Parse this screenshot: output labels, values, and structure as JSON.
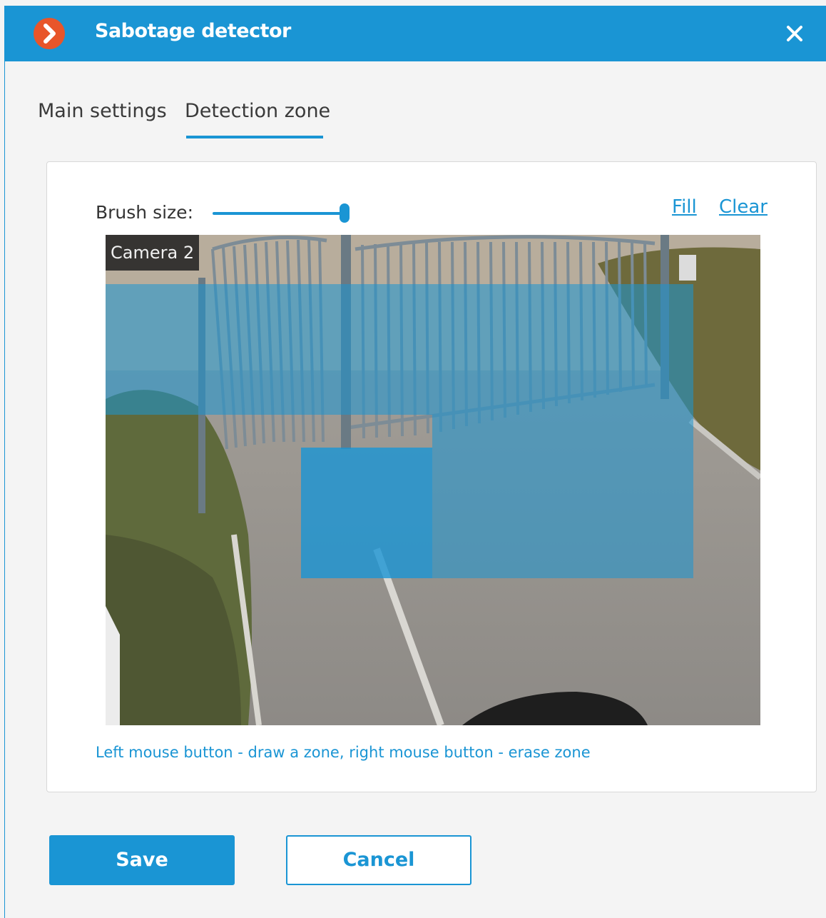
{
  "window": {
    "title": "Sabotage detector",
    "close_icon": "close-icon",
    "logo_icon": "chevron-right-circle-icon"
  },
  "tabs": [
    {
      "label": "Main settings",
      "selected": false
    },
    {
      "label": "Detection zone",
      "selected": true
    }
  ],
  "brush": {
    "label": "Brush size:",
    "value_fraction": 1.0
  },
  "actions": {
    "fill_label": "Fill",
    "clear_label": "Clear"
  },
  "camera": {
    "label": "Camera 2",
    "zone_color": "#1a95d4"
  },
  "hint": "Left mouse button - draw a zone, right mouse button - erase zone",
  "buttons": {
    "save_label": "Save",
    "cancel_label": "Cancel"
  },
  "colors": {
    "accent": "#1a95d4",
    "logo": "#e8552a"
  }
}
